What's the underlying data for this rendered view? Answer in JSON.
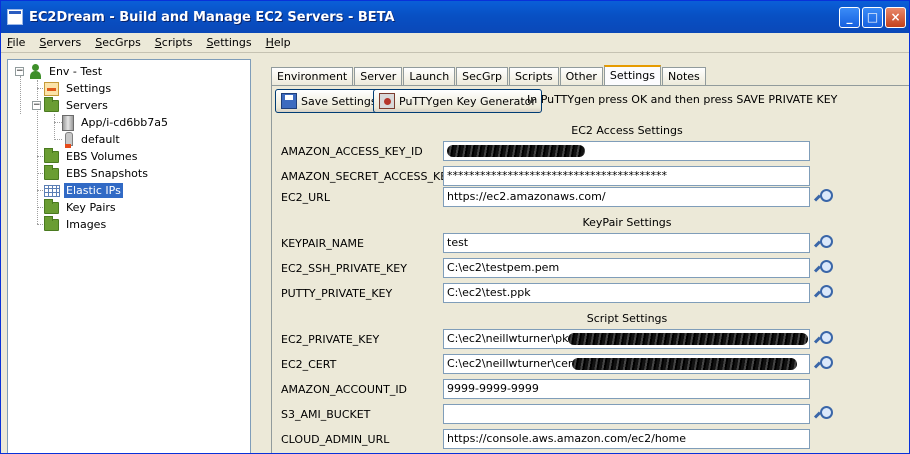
{
  "window": {
    "title": "EC2Dream - Build and Manage EC2 Servers - BETA"
  },
  "titlebar_buttons": {
    "minimize": "_",
    "maximize": "□",
    "close": "×"
  },
  "menu": [
    "File",
    "Servers",
    "SecGrps",
    "Scripts",
    "Settings",
    "Help"
  ],
  "tree": {
    "root": "Env - Test",
    "settings": "Settings",
    "servers": "Servers",
    "server_items": [
      "App/i-cd6bb7a5",
      "default"
    ],
    "ebs_volumes": "EBS Volumes",
    "ebs_snapshots": "EBS Snapshots",
    "elastic_ips": "Elastic IPs",
    "key_pairs": "Key Pairs",
    "images": "Images",
    "expander_collapse": "−"
  },
  "tabs": [
    "Environment",
    "Server",
    "Launch",
    "SecGrp",
    "Scripts",
    "Other",
    "Settings",
    "Notes"
  ],
  "active_tab": "Settings",
  "toolbar": {
    "save_label": "Save Settings",
    "puttygen_label": "PuTTYgen Key Generator",
    "hint": "In PuTTYgen press OK and then press SAVE PRIVATE KEY"
  },
  "sections": {
    "ec2_access": "EC2 Access Settings",
    "keypair": "KeyPair Settings",
    "script": "Script Settings"
  },
  "fields": {
    "access_key_label": "AMAZON_ACCESS_KEY_ID",
    "access_key_value": "",
    "secret_key_label": "AMAZON_SECRET_ACCESS_KEY",
    "secret_key_value": "****************************************",
    "ec2_url_label": "EC2_URL",
    "ec2_url_value": "https://ec2.amazonaws.com/",
    "keypair_name_label": "KEYPAIR_NAME",
    "keypair_name_value": "test",
    "ssh_key_label": "EC2_SSH_PRIVATE_KEY",
    "ssh_key_value": "C:\\ec2\\testpem.pem",
    "putty_key_label": "PUTTY_PRIVATE_KEY",
    "putty_key_value": "C:\\ec2\\test.ppk",
    "private_key_label": "EC2_PRIVATE_KEY",
    "private_key_value": "C:\\ec2\\neillwturner\\pk",
    "cert_label": "EC2_CERT",
    "cert_value": "C:\\ec2\\neillwturner\\cer",
    "account_id_label": "AMAZON_ACCOUNT_ID",
    "account_id_value": "9999-9999-9999",
    "s3_bucket_label": "S3_AMI_BUCKET",
    "s3_bucket_value": "",
    "admin_url_label": "CLOUD_ADMIN_URL",
    "admin_url_value": "https://console.aws.amazon.com/ec2/home"
  }
}
